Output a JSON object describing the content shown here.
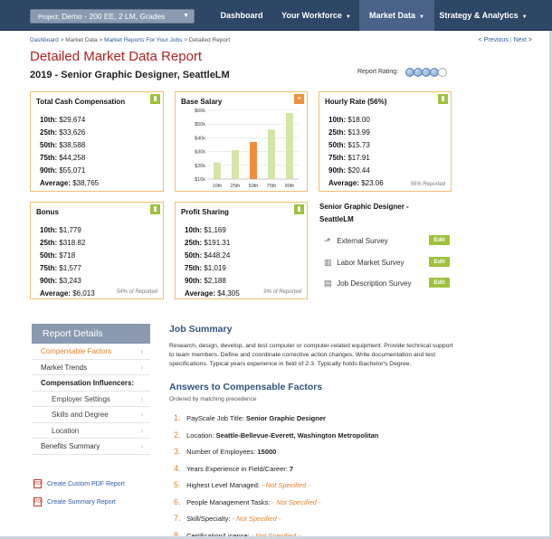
{
  "header": {
    "project_label": "Project:",
    "project_value": "Demo - 200 EE, 2 LM, Grades",
    "nav": [
      {
        "label": "Dashboard",
        "dropdown": false
      },
      {
        "label": "Your Workforce",
        "dropdown": true
      },
      {
        "label": "Market Data",
        "dropdown": true
      },
      {
        "label": "Strategy & Analytics",
        "dropdown": true
      }
    ],
    "active_nav": "Market Data"
  },
  "breadcrumb": {
    "items": [
      "Dashboard",
      "Market Data",
      "Market Reports For Your Jobs",
      "Detailed Report"
    ],
    "sep": " > "
  },
  "pager": {
    "prev": "< Previous",
    "sep": "|",
    "next": "Next >"
  },
  "page": {
    "title": "Detailed Market Data Report",
    "subtitle": "2019 - Senior Graphic Designer, SeattleLM",
    "rating_label": "Report Rating:",
    "rating_filled": 4,
    "rating_total": 5
  },
  "cards": {
    "total_cash": {
      "title": "Total Cash Compensation",
      "rows": [
        {
          "k": "10th:",
          "v": "$29,674"
        },
        {
          "k": "25th:",
          "v": "$33,626"
        },
        {
          "k": "50th:",
          "v": "$38,588"
        },
        {
          "k": "75th:",
          "v": "$44,258"
        },
        {
          "k": "90th:",
          "v": "$55,071"
        },
        {
          "k": "Average:",
          "v": "$38,765"
        }
      ]
    },
    "base_salary": {
      "title": "Base Salary"
    },
    "hourly": {
      "title": "Hourly Rate (56%)",
      "rows": [
        {
          "k": "10th:",
          "v": "$18.00"
        },
        {
          "k": "25th:",
          "v": "$13.99"
        },
        {
          "k": "50th:",
          "v": "$15.73"
        },
        {
          "k": "75th:",
          "v": "$17.91"
        },
        {
          "k": "90th:",
          "v": "$20.44"
        },
        {
          "k": "Average:",
          "v": "$23.06"
        }
      ],
      "note": "56% Reported"
    },
    "bonus": {
      "title": "Bonus",
      "rows": [
        {
          "k": "10th:",
          "v": "$1,779"
        },
        {
          "k": "25th:",
          "v": "$318.82"
        },
        {
          "k": "50th:",
          "v": "$718"
        },
        {
          "k": "75th:",
          "v": "$1,577"
        },
        {
          "k": "90th:",
          "v": "$3,243"
        },
        {
          "k": "Average:",
          "v": "$6,013"
        }
      ],
      "note": "54% of Reported"
    },
    "profit": {
      "title": "Profit Sharing",
      "rows": [
        {
          "k": "10th:",
          "v": "$1,169"
        },
        {
          "k": "25th:",
          "v": "$191.31"
        },
        {
          "k": "50th:",
          "v": "$448.24"
        },
        {
          "k": "75th:",
          "v": "$1,019"
        },
        {
          "k": "90th:",
          "v": "$2,188"
        },
        {
          "k": "Average:",
          "v": "$4,305"
        }
      ],
      "note": "9% of Reported"
    }
  },
  "chart_data": {
    "type": "bar",
    "title": "Base Salary",
    "categories": [
      "10th",
      "25th",
      "50th",
      "75th",
      "90th"
    ],
    "values": [
      22000,
      31000,
      37000,
      46000,
      58000
    ],
    "highlight": "50th",
    "ylim": [
      10000,
      60000
    ],
    "yticks": [
      "$10k",
      "$15k",
      "$20k",
      "$25k",
      "$30k",
      "$40k",
      "$50k",
      "$60k"
    ],
    "yticks_shown": [
      "$60k",
      "$50k",
      "$40k",
      "$30k",
      "$20k",
      "$10k"
    ],
    "bar_color": "#d4e6a6",
    "highlight_color": "#ef8f3b",
    "grid": true
  },
  "survey": {
    "title": "Senior Graphic Designer - SeattleLM",
    "items": [
      {
        "label": "External Survey",
        "icon": "chart-up-icon",
        "button": "Edit"
      },
      {
        "label": "Labor Market Survey",
        "icon": "bar-chart-icon",
        "button": "Edit"
      },
      {
        "label": "Job Description Survey",
        "icon": "briefcase-icon",
        "button": "Edit"
      }
    ]
  },
  "sidebar": {
    "title": "Report Details",
    "items": [
      {
        "label": "Compensable Factors",
        "type": "active"
      },
      {
        "label": "Market Trends",
        "type": "item"
      },
      {
        "label": "Compensation Influencers:",
        "type": "hdr"
      },
      {
        "label": "Employer Settings",
        "type": "sub"
      },
      {
        "label": "Skills and Degree",
        "type": "sub"
      },
      {
        "label": "Location",
        "type": "sub"
      },
      {
        "label": "Benefits Summary",
        "type": "item"
      }
    ],
    "links": [
      "Create Custom PDF Report",
      "Create Summary Report"
    ]
  },
  "main": {
    "job_summary_title": "Job Summary",
    "job_summary_text": "Research, design, develop, and test computer or computer-related equipment. Provide technical support to team members. Define and coordinate corrective action changes. Write documentation and test specifications. Typical years experience in field of 2-3. Typically holds Bachelor's Degree.",
    "answers_title": "Answers to Compensable Factors",
    "answers_sub": "Ordered by matching precedence",
    "answers": [
      {
        "n": "1.",
        "label": "PayScale Job Title:",
        "value": "Senior Graphic Designer",
        "ns": false
      },
      {
        "n": "2.",
        "label": "Location:",
        "value": "Seattle-Bellevue-Everett, Washington Metropolitan",
        "ns": false
      },
      {
        "n": "3.",
        "label": "Number of Employees:",
        "value": "15000",
        "ns": false
      },
      {
        "n": "4.",
        "label": "Years Experience in Field/Career:",
        "value": "7",
        "ns": false
      },
      {
        "n": "5.",
        "label": "Highest Level Managed:",
        "value": "- Not Specified -",
        "ns": true
      },
      {
        "n": "6.",
        "label": "People Management Tasks:",
        "value": "- Not Specified -",
        "ns": true
      },
      {
        "n": "7.",
        "label": "Skill/Specialty:",
        "value": "- Not Specified -",
        "ns": true
      },
      {
        "n": "8.",
        "label": "Certification/License:",
        "value": "- Not Specified -",
        "ns": true
      }
    ]
  }
}
